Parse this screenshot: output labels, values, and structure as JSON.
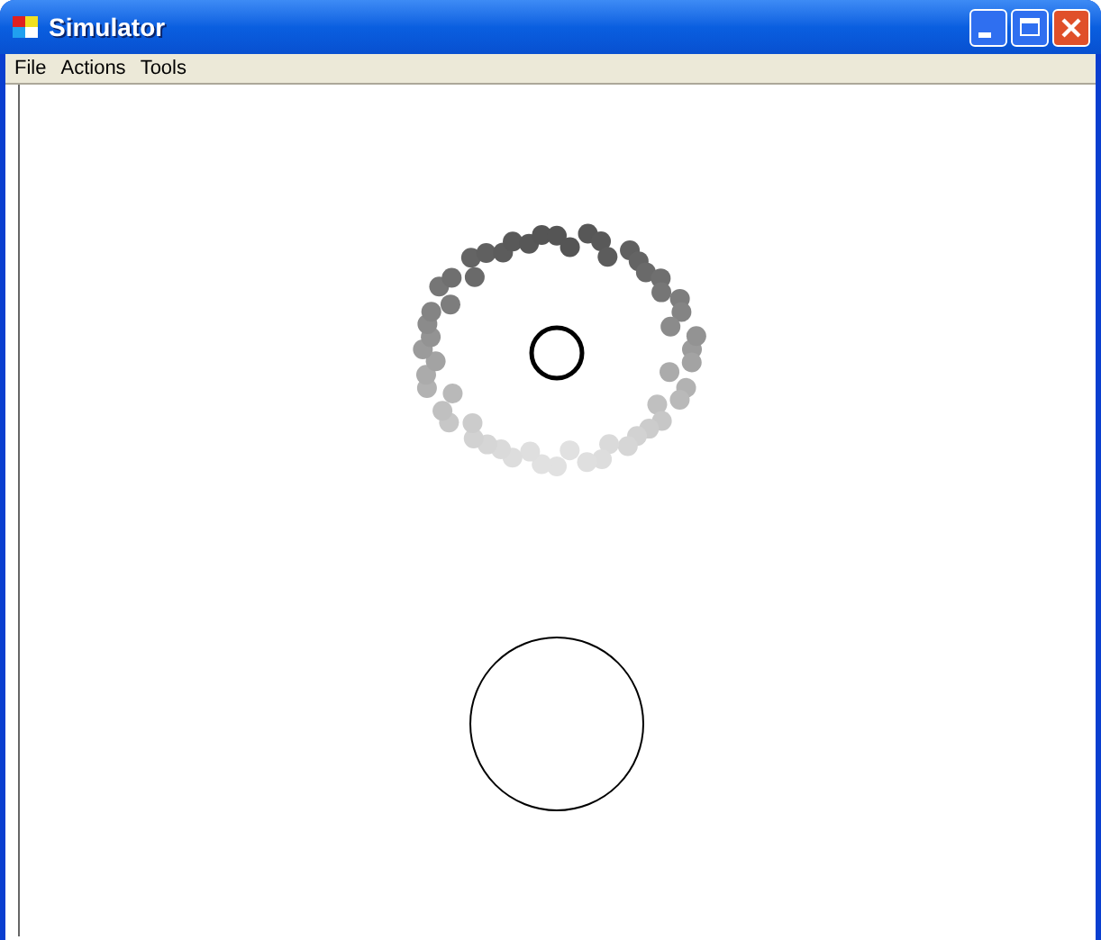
{
  "window": {
    "title": "Simulator"
  },
  "menu": [
    {
      "label": "File"
    },
    {
      "label": "Actions"
    },
    {
      "label": "Tools"
    }
  ]
}
